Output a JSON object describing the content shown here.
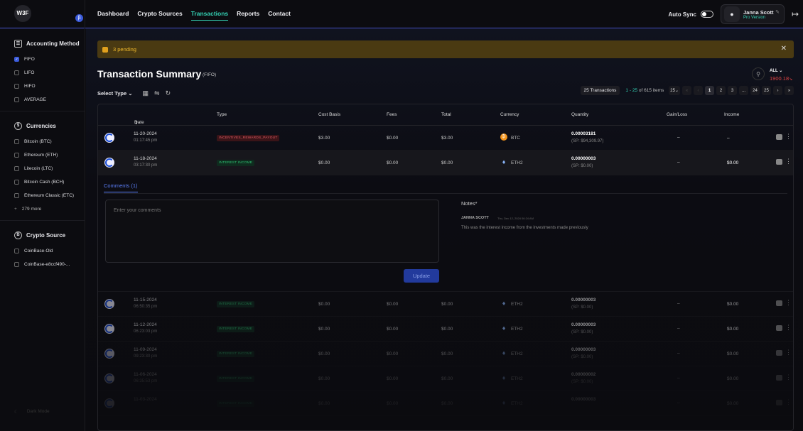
{
  "brand": {
    "logo": "W3F",
    "badge": "β"
  },
  "nav": {
    "items": [
      "Dashboard",
      "Crypto Sources",
      "Transactions",
      "Reports",
      "Contact"
    ],
    "active": "Transactions"
  },
  "topright": {
    "autosync_label": "Auto Sync",
    "user_name": "Janna Scott",
    "user_plan": "Pro Version"
  },
  "sidebar": {
    "accounting": {
      "title": "Accounting Method",
      "options": [
        "FIFO",
        "LIFO",
        "HIFO",
        "AVERAGE"
      ],
      "selected": "FIFO"
    },
    "currencies": {
      "title": "Currencies",
      "items": [
        "Bitcoin (BTC)",
        "Ethereum (ETH)",
        "Litecoin (LTC)",
        "Bitcoin Cash (BCH)",
        "Ethereum Classic (ETC)"
      ],
      "more": "279 more"
    },
    "crypto_source": {
      "title": "Crypto Source",
      "items": [
        "CoinBase-Old",
        "CoinBase-e8ccf490-..."
      ]
    },
    "dark_mode": "Dark Mode"
  },
  "banner": {
    "text": "3 pending"
  },
  "summary": {
    "title": "Transaction Summary",
    "method": "(FIFO)",
    "all_label": "ALL",
    "all_value": "1900.18"
  },
  "toolbar": {
    "select_type": "Select Type",
    "tx_count": "25 Transactions",
    "range_prefix": "1 - 25",
    "range_suffix": "of 615 items",
    "page_size": "25",
    "pages": [
      "1",
      "2",
      "3",
      "...",
      "24",
      "25"
    ]
  },
  "table": {
    "headers": [
      "Date",
      "Type",
      "Cost Basis",
      "Fees",
      "Total",
      "Currency",
      "Quantity",
      "Gain/Loss",
      "Income"
    ],
    "rows": [
      {
        "date": "11-20-2024",
        "time": "01:17:45 pm",
        "type": "INCENTIVES_REWARDS_PAYOUT",
        "type_color": "red",
        "cost": "$3.00",
        "fees": "$0.00",
        "total": "$3.00",
        "cur": "BTC",
        "qty": "0.00003181",
        "sp": "(SP: $94,309.97)",
        "gain": "–",
        "income": "–"
      },
      {
        "date": "11-18-2024",
        "time": "03:17:30 pm",
        "type": "INTEREST INCOME",
        "type_color": "green",
        "cost": "$0.00",
        "fees": "$0.00",
        "total": "$0.00",
        "cur": "ETH2",
        "qty": "0.00000003",
        "sp": "(SP: $0.00)",
        "gain": "–",
        "income": "$0.00"
      },
      {
        "date": "11-15-2024",
        "time": "06:50:35 pm",
        "type": "INTEREST INCOME",
        "type_color": "green",
        "cost": "$0.00",
        "fees": "$0.00",
        "total": "$0.00",
        "cur": "ETH2",
        "qty": "0.00000003",
        "sp": "(SP: $0.00)",
        "gain": "–",
        "income": "$0.00"
      },
      {
        "date": "11-12-2024",
        "time": "06:23:03 pm",
        "type": "INTEREST INCOME",
        "type_color": "green",
        "cost": "$0.00",
        "fees": "$0.00",
        "total": "$0.00",
        "cur": "ETH2",
        "qty": "0.00000003",
        "sp": "(SP: $0.00)",
        "gain": "–",
        "income": "$0.00"
      },
      {
        "date": "11-09-2024",
        "time": "09:23:30 pm",
        "type": "INTEREST INCOME",
        "type_color": "green",
        "cost": "$0.00",
        "fees": "$0.00",
        "total": "$0.00",
        "cur": "ETH2",
        "qty": "0.00000003",
        "sp": "(SP: $0.00)",
        "gain": "–",
        "income": "$0.00"
      },
      {
        "date": "11-06-2024",
        "time": "06:35:53 pm",
        "type": "INTEREST INCOME",
        "type_color": "green",
        "cost": "$0.00",
        "fees": "$0.00",
        "total": "$0.00",
        "cur": "ETH2",
        "qty": "0.00000002",
        "sp": "(SP: $0.00)",
        "gain": "–",
        "income": "$0.00"
      },
      {
        "date": "11-03-2024",
        "time": "",
        "type": "INTEREST INCOME",
        "type_color": "green",
        "cost": "$0.00",
        "fees": "$0.00",
        "total": "$0.00",
        "cur": "ETH2",
        "qty": "0.00000003",
        "sp": "",
        "gain": "–",
        "income": "$0.00"
      }
    ]
  },
  "comments": {
    "tab": "Comments (1)",
    "placeholder": "Enter your comments",
    "update": "Update",
    "notes_title": "Notes*",
    "author": "JANNA SCOTT",
    "time": "Thu, Dec 12, 2024 06:24 AM",
    "text": "This was the interest income from the investments made previously"
  }
}
